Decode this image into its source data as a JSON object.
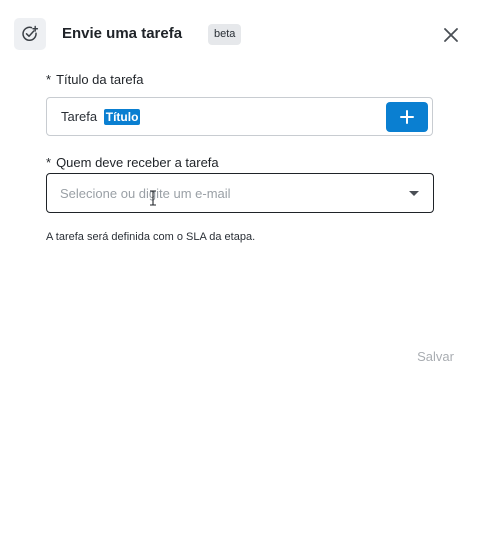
{
  "header": {
    "title": "Envie uma tarefa",
    "badge": "beta",
    "icon": "task-add-icon",
    "close_icon": "close-icon"
  },
  "form": {
    "task_title": {
      "required_mark": "*",
      "label": "Título da tarefa",
      "value_prefix": "Tarefa",
      "variable_chip": "Título",
      "add_button_icon": "plus-icon"
    },
    "recipient": {
      "required_mark": "*",
      "label": "Quem deve receber a tarefa",
      "placeholder": "Selecione ou digite um e-mail"
    },
    "hint": "A tarefa será definida com o SLA da etapa."
  },
  "footer": {
    "save_label": "Salvar"
  },
  "colors": {
    "accent": "#0a7fd1",
    "disabled_text": "#a9adb2"
  }
}
